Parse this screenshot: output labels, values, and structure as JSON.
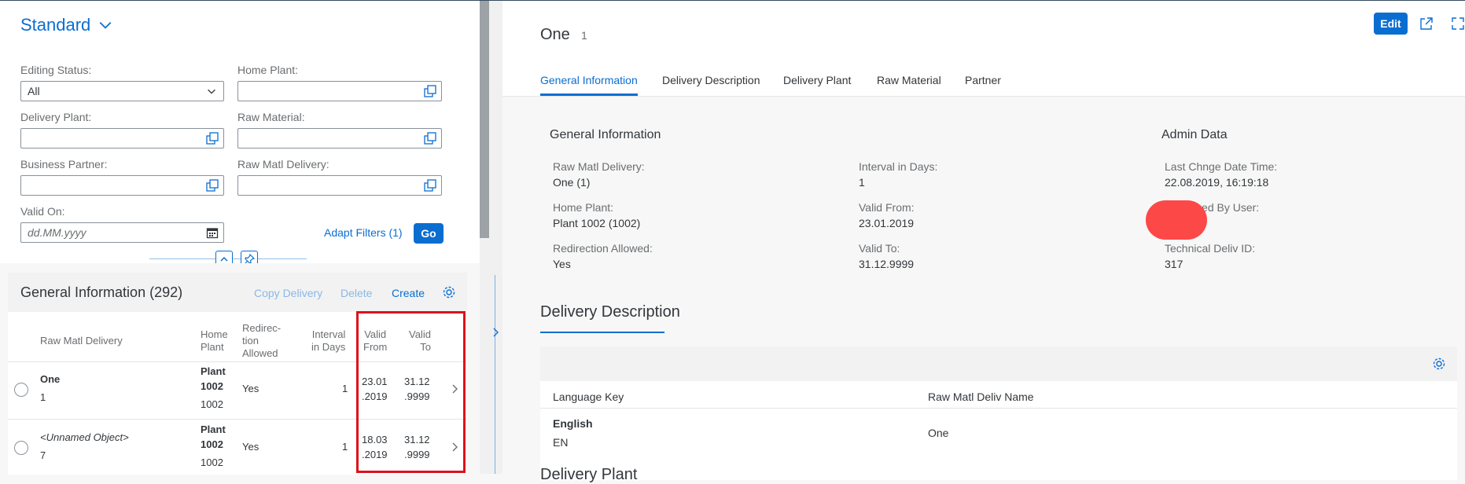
{
  "filterbar": {
    "variant": "Standard",
    "fields": {
      "editing_status": {
        "label": "Editing Status:",
        "value": "All"
      },
      "home_plant": {
        "label": "Home Plant:",
        "value": ""
      },
      "delivery_plant": {
        "label": "Delivery Plant:",
        "value": ""
      },
      "raw_material": {
        "label": "Raw Material:",
        "value": ""
      },
      "business_partner": {
        "label": "Business Partner:",
        "value": ""
      },
      "raw_matl_delivery": {
        "label": "Raw Matl Delivery:",
        "value": ""
      },
      "valid_on": {
        "label": "Valid On:",
        "placeholder": "dd.MM.yyyy"
      }
    },
    "adapt_filters": "Adapt Filters (1)",
    "go": "Go"
  },
  "table": {
    "title": "General Information (292)",
    "actions": {
      "copy": "Copy Delivery",
      "delete": "Delete",
      "create": "Create"
    },
    "columns": {
      "raw_matl_delivery": "Raw Matl Delivery",
      "home_plant": [
        "Home",
        "Plant"
      ],
      "redirection": [
        "Redirec-",
        "tion",
        "Allowed"
      ],
      "interval": [
        "Interval",
        "in Days"
      ],
      "valid_from": [
        "Valid",
        "From"
      ],
      "valid_to": [
        "Valid",
        "To"
      ]
    },
    "rows": [
      {
        "name": "One",
        "id": "1",
        "plant_name": [
          "Plant",
          "1002"
        ],
        "plant_id": "1002",
        "redirection": "Yes",
        "interval": "1",
        "valid_from": [
          "23.01",
          ".2019"
        ],
        "valid_to": [
          "31.12",
          ".9999"
        ]
      },
      {
        "name": "<Unnamed Object>",
        "id": "7",
        "plant_name": [
          "Plant",
          "1002"
        ],
        "plant_id": "1002",
        "redirection": "Yes",
        "interval": "1",
        "valid_from": [
          "18.03",
          ".2019"
        ],
        "valid_to": [
          "31.12",
          ".9999"
        ]
      }
    ]
  },
  "object": {
    "title": "One",
    "subtitle": "1",
    "edit": "Edit",
    "tabs": [
      "General Information",
      "Delivery Description",
      "Delivery Plant",
      "Raw Material",
      "Partner"
    ],
    "general": {
      "heading": "General Information",
      "raw_matl_delivery": {
        "label": "Raw Matl Delivery:",
        "value": "One (1)"
      },
      "home_plant": {
        "label": "Home Plant:",
        "value": "Plant 1002 (1002)"
      },
      "redirection": {
        "label": "Redirection Allowed:",
        "value": "Yes"
      },
      "interval": {
        "label": "Interval in Days:",
        "value": "1"
      },
      "valid_from": {
        "label": "Valid From:",
        "value": "23.01.2019"
      },
      "valid_to": {
        "label": "Valid To:",
        "value": "31.12.9999"
      }
    },
    "admin": {
      "heading": "Admin Data",
      "last_change": {
        "label": "Last Chnge Date Time:",
        "value": "22.08.2019, 16:19:18"
      },
      "changed_by": {
        "label": "...anged By User:"
      },
      "tech_id": {
        "label": "Technical Deliv ID:",
        "value": "317"
      }
    },
    "delivery_description": {
      "heading": "Delivery Description",
      "columns": {
        "language": "Language Key",
        "name": "Raw Matl Deliv Name"
      },
      "rows": [
        {
          "language": "English",
          "lang_code": "EN",
          "name": "One"
        }
      ]
    },
    "delivery_plant_heading": "Delivery Plant"
  }
}
